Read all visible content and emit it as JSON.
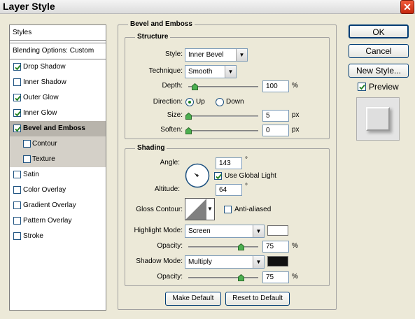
{
  "window": {
    "title": "Layer Style",
    "close_glyph": "✕"
  },
  "styles_panel": {
    "header": "Styles",
    "blending_options": "Blending Options: Custom",
    "items": [
      {
        "label": "Drop Shadow",
        "checked": true
      },
      {
        "label": "Inner Shadow",
        "checked": false
      },
      {
        "label": "Outer Glow",
        "checked": true
      },
      {
        "label": "Inner Glow",
        "checked": true
      },
      {
        "label": "Bevel and Emboss",
        "checked": true,
        "active": true
      },
      {
        "label": "Contour",
        "checked": false,
        "sub": true
      },
      {
        "label": "Texture",
        "checked": false,
        "sub": true
      },
      {
        "label": "Satin",
        "checked": false
      },
      {
        "label": "Color Overlay",
        "checked": false
      },
      {
        "label": "Gradient Overlay",
        "checked": false
      },
      {
        "label": "Pattern Overlay",
        "checked": false
      },
      {
        "label": "Stroke",
        "checked": false
      }
    ]
  },
  "bevel": {
    "title": "Bevel and Emboss",
    "structure": {
      "title": "Structure",
      "style_label": "Style:",
      "style_value": "Inner Bevel",
      "technique_label": "Technique:",
      "technique_value": "Smooth",
      "depth_label": "Depth:",
      "depth_value": "100",
      "depth_unit": "%",
      "direction_label": "Direction:",
      "direction_up": "Up",
      "direction_down": "Down",
      "size_label": "Size:",
      "size_value": "5",
      "size_unit": "px",
      "soften_label": "Soften:",
      "soften_value": "0",
      "soften_unit": "px"
    },
    "shading": {
      "title": "Shading",
      "angle_label": "Angle:",
      "angle_value": "143",
      "angle_unit": "°",
      "use_global_light": "Use Global Light",
      "altitude_label": "Altitude:",
      "altitude_value": "64",
      "altitude_unit": "°",
      "gloss_contour_label": "Gloss Contour:",
      "anti_aliased": "Anti-aliased",
      "highlight_mode_label": "Highlight Mode:",
      "highlight_mode_value": "Screen",
      "highlight_color": "#ffffff",
      "opacity_label": "Opacity:",
      "highlight_opacity": "75",
      "opacity_unit": "%",
      "shadow_mode_label": "Shadow Mode:",
      "shadow_mode_value": "Multiply",
      "shadow_color": "#111111",
      "shadow_opacity": "75"
    },
    "make_default": "Make Default",
    "reset_default": "Reset to Default"
  },
  "buttons": {
    "ok": "OK",
    "cancel": "Cancel",
    "new_style": "New Style...",
    "preview": "Preview"
  }
}
